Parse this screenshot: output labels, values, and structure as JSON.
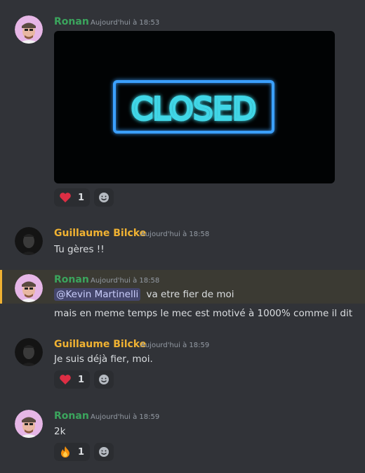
{
  "messages": [
    {
      "author": "Ronan",
      "timestamp": "Aujourd'hui à 18:53",
      "image_text": "CLOSED",
      "reaction_emoji": "heart",
      "reaction_count": "1"
    },
    {
      "author": "Guillaume Bilcke",
      "timestamp": "Aujourd'hui à 18:58",
      "text": "Tu gères !!"
    },
    {
      "author": "Ronan",
      "timestamp": "Aujourd'hui à 18:58",
      "mention": "@Kevin Martinelli",
      "text_after_mention": "va etre fier de moi",
      "text2": "mais en meme temps le mec est motivé à 1000% comme il dit"
    },
    {
      "author": "Guillaume Bilcke",
      "timestamp": "Aujourd'hui à 18:59",
      "text": "Je suis déjà fier, moi.",
      "reaction_emoji": "heart",
      "reaction_count": "1"
    },
    {
      "author": "Ronan",
      "timestamp": "Aujourd'hui à 18:59",
      "text": "2k",
      "reaction_emoji": "fire",
      "reaction_count": "1"
    }
  ],
  "colors": {
    "background": "#313338",
    "ronan_name": "#3ba55d",
    "guillaume_name": "#f0b232",
    "mention_highlight": "#3b3a33",
    "neon": "#3fd6e6"
  },
  "icons": [
    "heart-emoji",
    "fire-emoji",
    "add-reaction-icon"
  ]
}
